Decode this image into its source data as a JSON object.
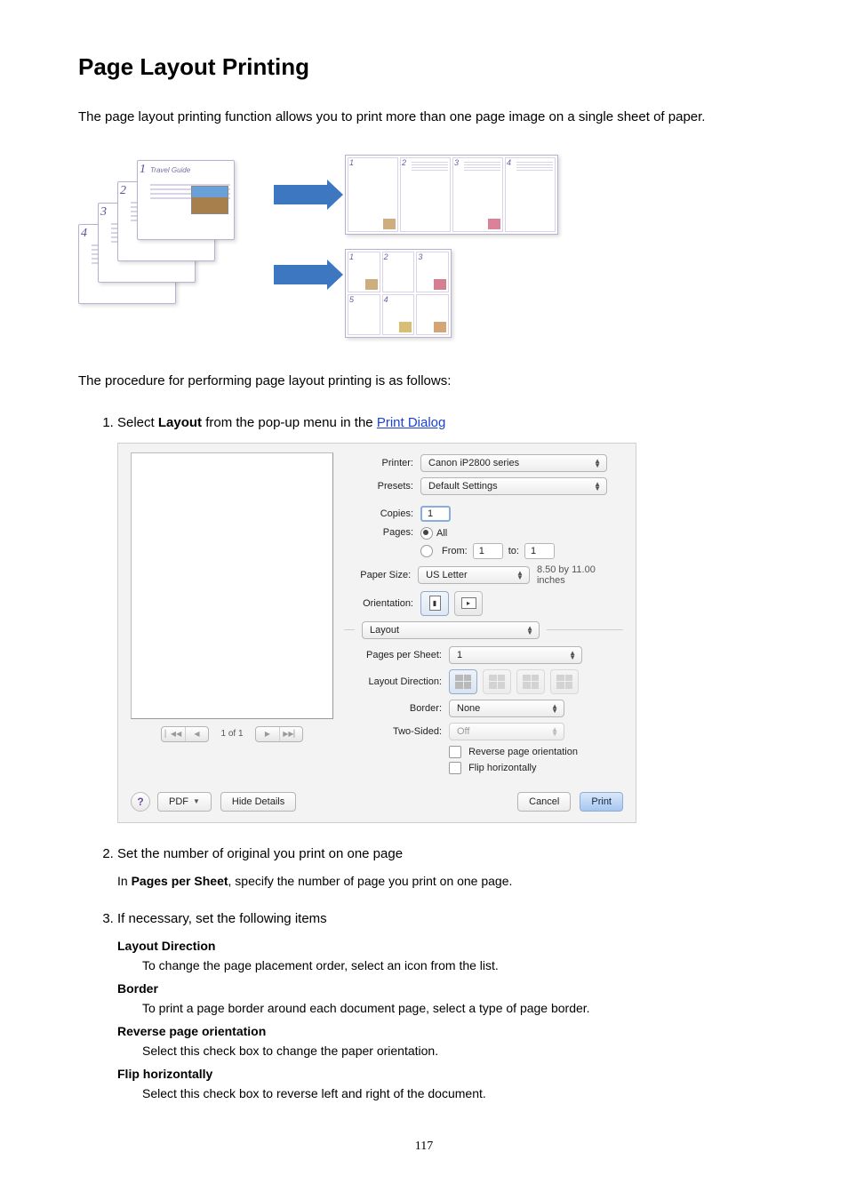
{
  "heading": "Page Layout Printing",
  "intro": "The page layout printing function allows you to print more than one page image on a single sheet of paper.",
  "procedure_line": "The procedure for performing page layout printing is as follows:",
  "steps": {
    "s1": {
      "pre": "Select ",
      "bold": "Layout",
      "mid": " from the pop-up menu in the ",
      "link": "Print Dialog"
    },
    "s2": {
      "title": "Set the number of original you print on one page",
      "body_pre": "In ",
      "body_bold": "Pages per Sheet",
      "body_post": ", specify the number of page you print on one page."
    },
    "s3": {
      "title": "If necessary, set the following items",
      "items": [
        {
          "term": "Layout Direction",
          "def": "To change the page placement order, select an icon from the list."
        },
        {
          "term": "Border",
          "def": "To print a page border around each document page, select a type of page border."
        },
        {
          "term": "Reverse page orientation",
          "def": "Select this check box to change the paper orientation."
        },
        {
          "term": "Flip horizontally",
          "def": "Select this check box to reverse left and right of the document."
        }
      ]
    }
  },
  "dialog": {
    "labels": {
      "printer": "Printer:",
      "presets": "Presets:",
      "copies": "Copies:",
      "pages": "Pages:",
      "from": "From:",
      "to": "to:",
      "paper_size": "Paper Size:",
      "orientation": "Orientation:",
      "pages_per_sheet": "Pages per Sheet:",
      "layout_direction": "Layout Direction:",
      "border": "Border:",
      "two_sided": "Two-Sided:"
    },
    "values": {
      "printer": "Canon iP2800 series",
      "presets": "Default Settings",
      "copies": "1",
      "pages_all": "All",
      "from": "1",
      "to": "1",
      "paper_size": "US Letter",
      "paper_dim": "8.50 by 11.00 inches",
      "panel": "Layout",
      "pages_per_sheet": "1",
      "border": "None",
      "two_sided": "Off",
      "reverse": "Reverse page orientation",
      "flip": "Flip horizontally"
    },
    "pager": "1 of 1",
    "buttons": {
      "pdf": "PDF",
      "hide_details": "Hide Details",
      "cancel": "Cancel",
      "print": "Print",
      "help": "?"
    }
  },
  "page_number": "117"
}
